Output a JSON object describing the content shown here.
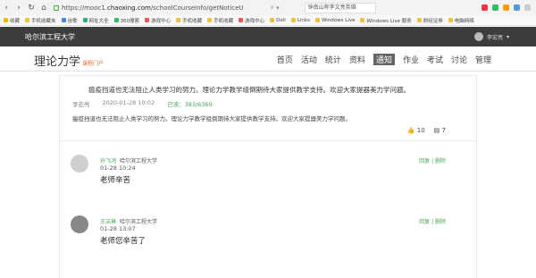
{
  "browser": {
    "url_prefix": "https://mooc1.",
    "url_domain": "chaoxing.com",
    "url_path": "/schoolCourseInfo/getNoticeU",
    "search_text": "钟南山称李文亮英雄",
    "bookmarks": [
      "收藏",
      "手机收藏夹",
      "谷歌",
      "网址大全",
      "360搜索",
      "游戏中心",
      "手机收藏",
      "手机收藏",
      "游戏中心",
      "Dell",
      "Links",
      "Windows Live",
      "Windows Live 服务",
      "财经证券",
      "电脑网络"
    ]
  },
  "topbar": {
    "school": "哈尔滨工程大学",
    "user_name": "李宏亮"
  },
  "course": {
    "title": "理论力学",
    "subtitle": "课程门户",
    "nav": [
      "首页",
      "活动",
      "统计",
      "资料",
      "通知",
      "作业",
      "考试",
      "讨论",
      "管理"
    ],
    "active_nav": "通知"
  },
  "notice": {
    "title": "瘟疫挡道也无法阻止人类学习的努力。理论力学教学组倒期待大家提供教学支持。欢迎大家提器美力学问题。",
    "author": "李宏亮",
    "datetime": "2020-01-28 10:02",
    "read_label": "已读：383/6369",
    "body": "瘟疫挡道也无法阻止人类学习的努力。理论力学教学组倒期待大家提供教学支持。欢迎大家提器美力学问题。",
    "likes": "10",
    "comments": "7"
  },
  "replies": [
    {
      "name": "孙飞鸿",
      "school": "哈尔滨工程大学",
      "time": "01-28 10:24",
      "text": "老师辛苦",
      "actions": "回复 | 删除"
    },
    {
      "name": "王洁琳",
      "school": "哈尔滨工程大学",
      "time": "01-28 13:07",
      "text": "老师您辛苦了",
      "actions": "回复 | 删除"
    }
  ]
}
